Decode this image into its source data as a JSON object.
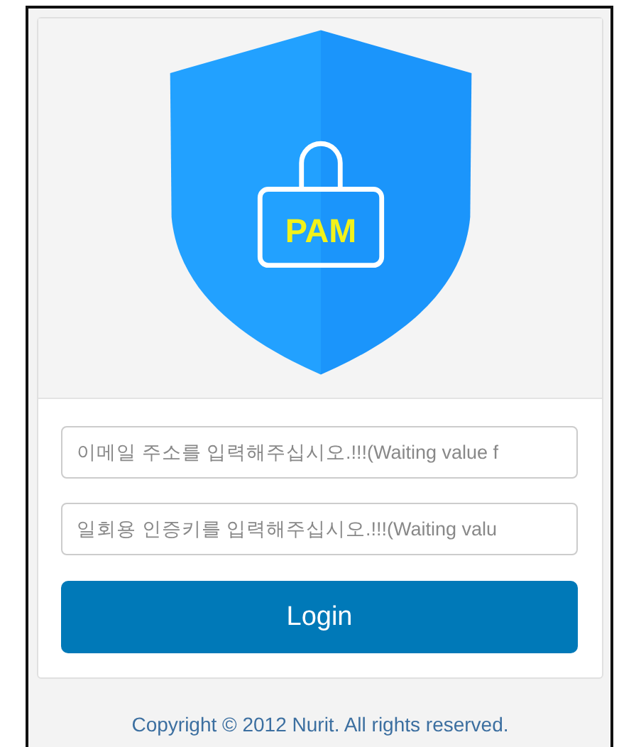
{
  "logo": {
    "text": "PAM"
  },
  "fields": [
    {
      "placeholder": "이메일 주소를 입력해주십시오.!!!(Waiting value f"
    },
    {
      "placeholder": "일회용 인증키를 입력해주십시오.!!!(Waiting valu"
    }
  ],
  "login_button": "Login",
  "footer": "Copyright © 2012 Nurit. All rights reserved."
}
